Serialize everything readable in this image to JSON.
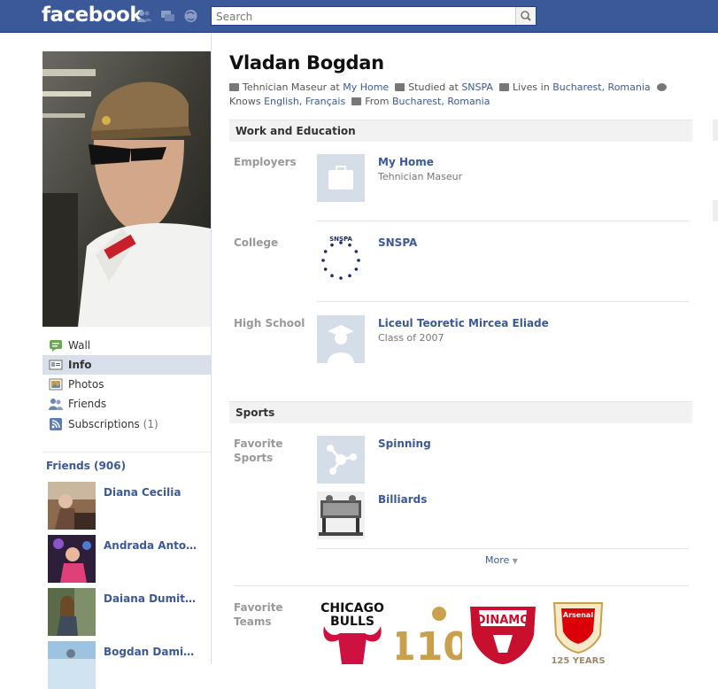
{
  "topbar": {
    "logo": "facebook",
    "search_placeholder": "Search"
  },
  "profile": {
    "name": "Vladan Bogdan",
    "summary": {
      "work_prefix": "Tehnician Maseur at",
      "work_place": "My Home",
      "study_prefix": "Studied at",
      "study_place": "SNSPA",
      "lives_prefix": "Lives in",
      "lives_place": "Bucharest, Romania",
      "knows_prefix": "Knows",
      "languages": "English, Français",
      "from_prefix": "From",
      "from_place": "Bucharest, Romania"
    }
  },
  "nav": {
    "items": [
      {
        "label": "Wall",
        "icon": "wall-icon"
      },
      {
        "label": "Info",
        "icon": "info-icon"
      },
      {
        "label": "Photos",
        "icon": "photos-icon"
      },
      {
        "label": "Friends",
        "icon": "friends-icon"
      },
      {
        "label": "Subscriptions",
        "icon": "subscriptions-icon"
      }
    ],
    "subscriptions_count": "(1)"
  },
  "friends": {
    "heading": "Friends (906)",
    "list": [
      "Diana Cecilia",
      "Andrada Antonia",
      "Daiana Dumitre…",
      "Bogdan Damian"
    ]
  },
  "work_education": {
    "heading": "Work and Education",
    "employers_label": "Employers",
    "employer_name": "My Home",
    "employer_role": "Tehnician Maseur",
    "college_label": "College",
    "college_name": "SNSPA",
    "college_logo_text": "SNSPA",
    "highschool_label": "High School",
    "highschool_name": "Liceul Teoretic Mircea Eliade",
    "highschool_class": "Class of 2007"
  },
  "sports": {
    "heading": "Sports",
    "fav_sports_label": "Favorite Sports",
    "sport_1": "Spinning",
    "sport_2": "Billiards",
    "more": "More",
    "fav_teams_label": "Favorite Teams",
    "teams": [
      "CHICAGO BULLS",
      "110",
      "DINAMO",
      "Arsenal 125 YEARS"
    ]
  },
  "colors": {
    "brand": "#3b5998",
    "nav_active": "#d8dfea"
  }
}
